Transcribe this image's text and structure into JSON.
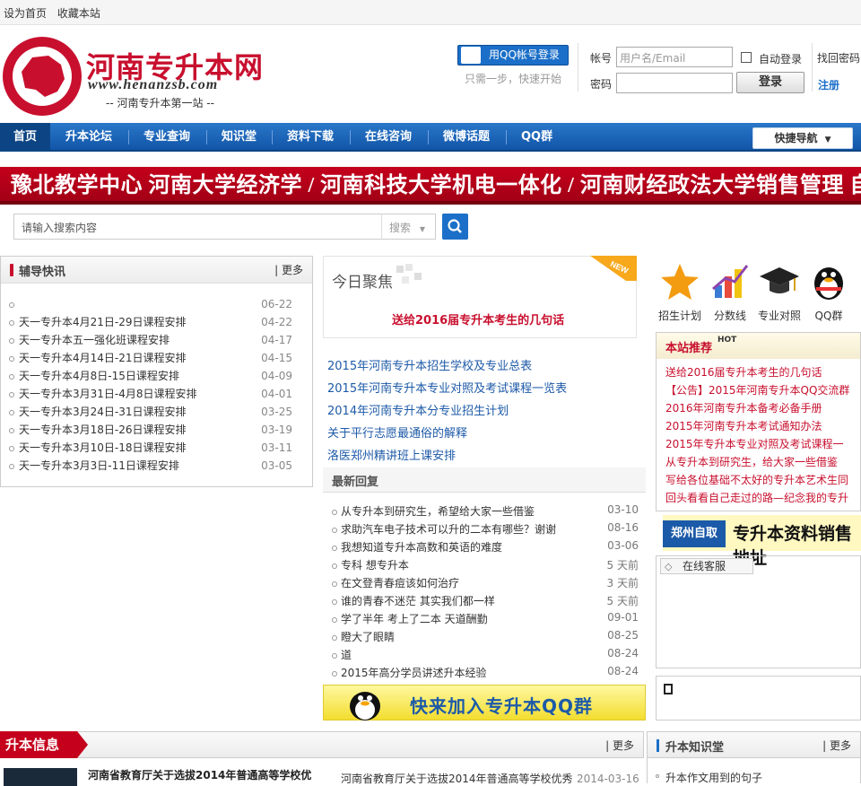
{
  "topbar": {
    "set_home": "设为首页",
    "bookmark": "收藏本站"
  },
  "logo": {
    "name": "河南专升本网",
    "url": "www.henanzsb.com",
    "slogan": "-- 河南专升本第一站 --"
  },
  "login": {
    "qq_button": "用QQ帐号登录",
    "qq_tip": "只需一步，快速开始",
    "account_label": "帐号",
    "account_placeholder": "用户名/Email",
    "password_label": "密码",
    "auto_login": "自动登录",
    "forgot": "找回密码",
    "register": "注册",
    "login_button": "登录"
  },
  "nav": {
    "items": [
      "首页",
      "升本论坛",
      "专业查询",
      "知识堂",
      "资料下载",
      "在线咨询",
      "微博话题",
      "QQ群"
    ],
    "quick": "快捷导航"
  },
  "banner": {
    "text": "豫北教学中心 河南大学经济学 / 河南科技大学机电一体化 / 河南财经政法大学销售管理 自考专升本"
  },
  "search": {
    "placeholder": "请输入搜索内容",
    "select": "搜索"
  },
  "tutoring": {
    "title": "辅导快讯",
    "more": "| 更多",
    "items": [
      {
        "title": "",
        "date": "06-22"
      },
      {
        "title": "天一专升本4月21日-29日课程安排",
        "date": "04-22"
      },
      {
        "title": "天一专升本五一强化班课程安排",
        "date": "04-17"
      },
      {
        "title": "天一专升本4月14日-21日课程安排",
        "date": "04-15"
      },
      {
        "title": "天一专升本4月8日-15日课程安排",
        "date": "04-09"
      },
      {
        "title": "天一专升本3月31日-4月8日课程安排",
        "date": "04-01"
      },
      {
        "title": "天一专升本3月24日-31日课程安排",
        "date": "03-25"
      },
      {
        "title": "天一专升本3月18日-26日课程安排",
        "date": "03-19"
      },
      {
        "title": "天一专升本3月10日-18日课程安排",
        "date": "03-11"
      },
      {
        "title": "天一专升本3月3日-11日课程安排",
        "date": "03-05"
      }
    ]
  },
  "focus": {
    "title": "今日聚焦",
    "badge": "NEW",
    "headline": "送给2016届专升本考生的几句话",
    "links": [
      "2015年河南专升本招生学校及专业总表",
      "2015年河南专升本专业对照及考试课程一览表",
      "2014年河南专升本分专业招生计划",
      "关于平行志愿最通俗的解释",
      "洛医郑州精讲班上课安排"
    ]
  },
  "replies": {
    "title": "最新回复",
    "items": [
      {
        "title": "从专升本到研究生，希望给大家一些借鉴",
        "date": "03-10"
      },
      {
        "title": "求助汽车电子技术可以升的二本有哪些？谢谢",
        "date": "08-16"
      },
      {
        "title": "我想知道专升本高数和英语的难度",
        "date": "03-06"
      },
      {
        "title": "专科 想专升本",
        "date": "5 天前"
      },
      {
        "title": "在文登青春痘该如何治疗",
        "date": "3 天前"
      },
      {
        "title": "谁的青春不迷茫 其实我们都一样",
        "date": "5 天前"
      },
      {
        "title": "学了半年 考上了二本 天道酬勤",
        "date": "09-01"
      },
      {
        "title": "瞪大了眼睛",
        "date": "08-25"
      },
      {
        "title": "道",
        "date": "08-24"
      },
      {
        "title": "2015年高分学员讲述升本经验",
        "date": "08-24"
      }
    ]
  },
  "qq_banner": "快来加入专升本QQ群",
  "icons": [
    {
      "label": "招生计划",
      "icon": "star-icon"
    },
    {
      "label": "分数线",
      "icon": "chart-icon"
    },
    {
      "label": "专业对照",
      "icon": "graduation-cap-icon"
    },
    {
      "label": "QQ群",
      "icon": "penguin-icon"
    }
  ],
  "recommend": {
    "title": "本站推荐",
    "badge": "HOT",
    "items": [
      "送给2016届专升本考生的几句话",
      "【公告】2015年河南专升本QQ交流群",
      "2016年河南专升本备考必备手册",
      "2015年河南专升本考试通知办法",
      "2015年专升本专业对照及考试课程一",
      "从专升本到研究生，给大家一些借鉴",
      "写给各位基础不太好的专升本艺术生同",
      "回头看看自己走过的路—纪念我的专升"
    ]
  },
  "zz_banner": {
    "tag": "郑州自取",
    "text": "专升本资料销售地址"
  },
  "kefu": {
    "tab": "在线客服"
  },
  "bottom": {
    "info_title": "升本信息",
    "info_more": "| 更多",
    "info_left": "河南省教育厅关于选拔2014年普通高等学校优",
    "info_mid": "河南省教育厅关于选拔2014年普通高等学校优秀",
    "info_date": "2014-03-16",
    "knowledge_title": "升本知识堂",
    "knowledge_more": "| 更多",
    "knowledge_item": "升本作文用到的句子"
  },
  "colors": {
    "brand_red": "#c8102e",
    "nav_blue": "#1b6fc8",
    "link_blue": "#1d5aa8"
  }
}
